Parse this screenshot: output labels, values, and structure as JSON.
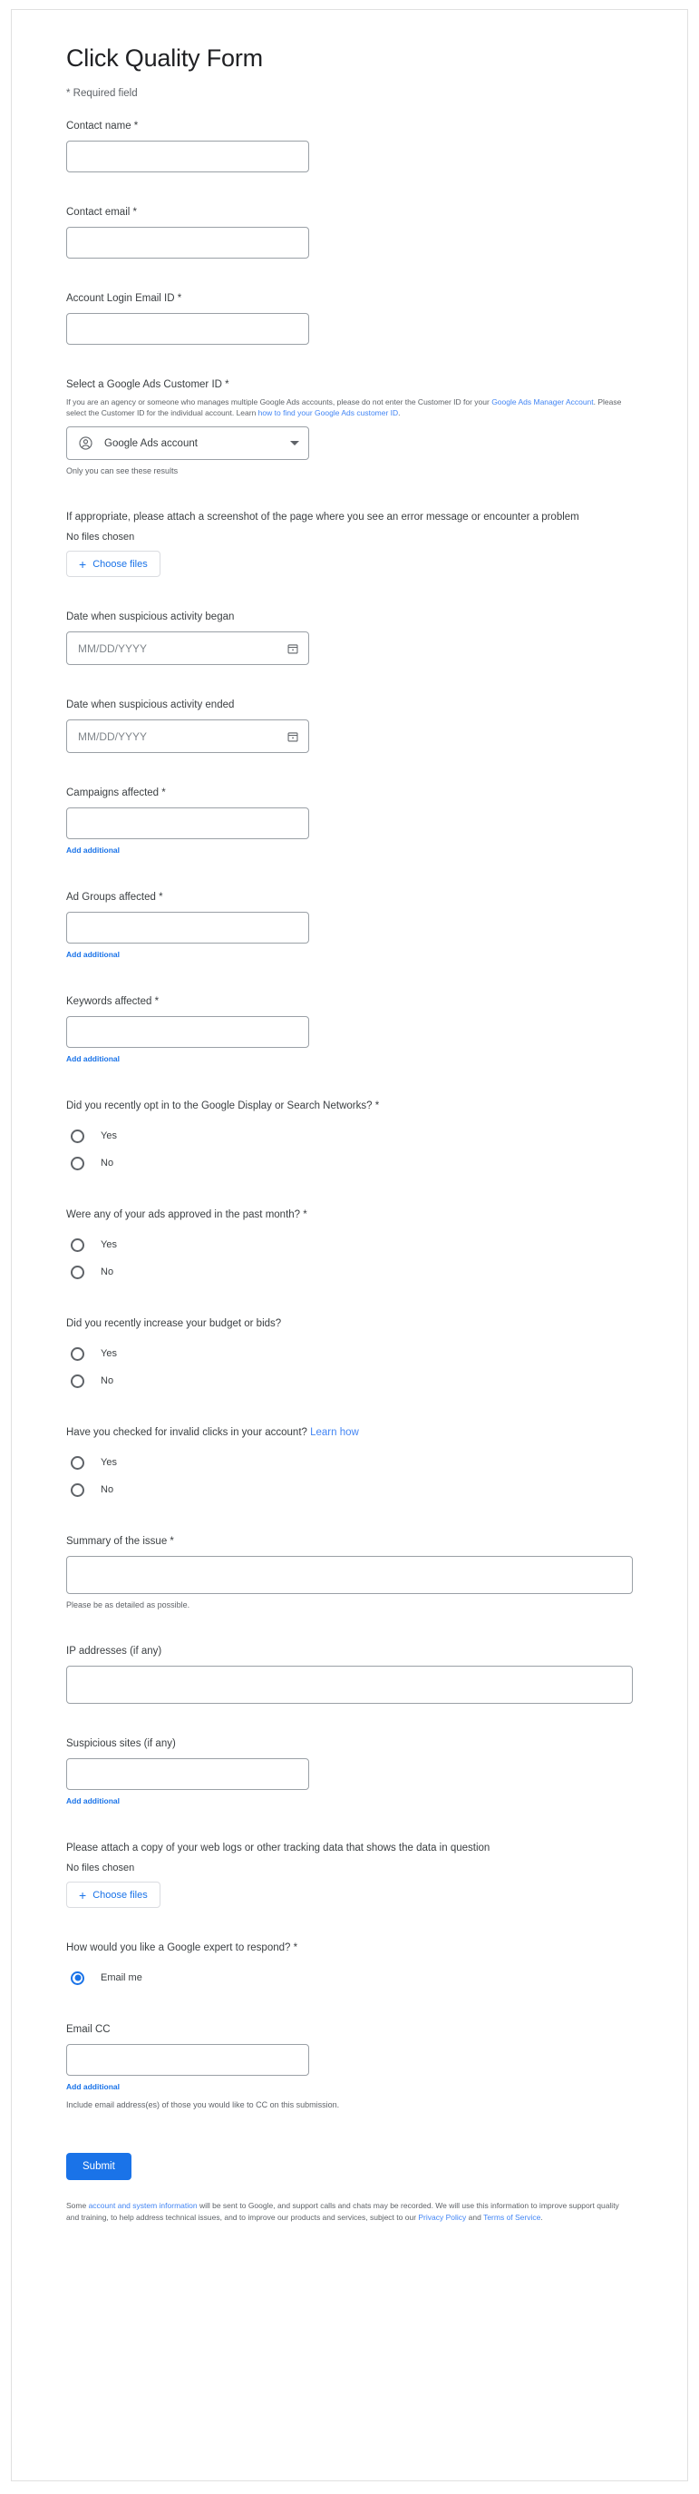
{
  "form": {
    "title": "Click Quality Form",
    "required_note": "* Required field",
    "accent_color": "#1a73e8",
    "link_color": "#4285f4"
  },
  "fields": {
    "contact_name": {
      "label": "Contact name *",
      "value": "",
      "placeholder": ""
    },
    "contact_email": {
      "label": "Contact email *",
      "value": "",
      "placeholder": ""
    },
    "account_login_email": {
      "label": "Account Login Email ID *",
      "value": "",
      "placeholder": ""
    }
  },
  "customer_id": {
    "label": "Select a Google Ads Customer ID *",
    "help_part1": "If you are an agency or someone who manages multiple Google Ads accounts, please do not enter the Customer ID for your ",
    "help_link1": "Google Ads Manager Account",
    "help_part2": ". Please select the Customer ID for the individual account. Learn ",
    "help_link2": "how to find your Google Ads customer ID",
    "help_part3": ".",
    "selected_option": "Google Ads account",
    "icon": "account-circle-icon",
    "caret_icon": "chevron-down-icon",
    "sub_note": "Only you can see these results"
  },
  "screenshot_upload": {
    "label": "If appropriate, please attach a screenshot of the page where you see an error message or encounter a problem",
    "no_files_text": "No files chosen",
    "button_label": "Choose files",
    "plus_icon": "plus-icon"
  },
  "dates": {
    "began": {
      "label": "Date when suspicious activity began",
      "placeholder": "MM/DD/YYYY",
      "value": "",
      "icon": "calendar-icon"
    },
    "ended": {
      "label": "Date when suspicious activity ended",
      "placeholder": "MM/DD/YYYY",
      "value": "",
      "icon": "calendar-icon"
    }
  },
  "affected": {
    "campaigns": {
      "label": "Campaigns affected *",
      "value": "",
      "add_label": "Add additional"
    },
    "ad_groups": {
      "label": "Ad Groups affected *",
      "value": "",
      "add_label": "Add additional"
    },
    "keywords": {
      "label": "Keywords affected *",
      "value": "",
      "add_label": "Add additional"
    }
  },
  "questions": [
    {
      "label": "Did you recently opt in to the Google Display or Search Networks? *",
      "options": [
        "Yes",
        "No"
      ],
      "selected": null
    },
    {
      "label": "Were any of your ads approved in the past month? *",
      "options": [
        "Yes",
        "No"
      ],
      "selected": null
    },
    {
      "label": "Did you recently increase your budget or bids?",
      "options": [
        "Yes",
        "No"
      ],
      "selected": null
    },
    {
      "label": "Have you checked for invalid clicks in your account? ",
      "link_label": "Learn how",
      "options": [
        "Yes",
        "No"
      ],
      "selected": null
    }
  ],
  "summary": {
    "label": "Summary of the issue *",
    "value": "",
    "hint": "Please be as detailed as possible."
  },
  "ip_addresses": {
    "label": "IP addresses (if any)",
    "value": ""
  },
  "suspicious_sites": {
    "label": "Suspicious sites (if any)",
    "value": "",
    "add_label": "Add additional"
  },
  "weblogs_upload": {
    "label": "Please attach a copy of your web logs or other tracking data that shows the data in question",
    "no_files_text": "No files chosen",
    "button_label": "Choose files",
    "plus_icon": "plus-icon"
  },
  "respond": {
    "label": "How would you like a Google expert to respond? *",
    "options": [
      "Email me"
    ],
    "selected": "Email me"
  },
  "email_cc": {
    "label": "Email CC",
    "value": "",
    "add_label": "Add additional",
    "hint": "Include email address(es) of those you would like to CC on this submission."
  },
  "submit": {
    "label": "Submit"
  },
  "legal": {
    "part1": "Some ",
    "link1": "account and system information",
    "part2": " will be sent to Google, and support calls and chats may be recorded. We will use this information to improve support quality and training, to help address technical issues, and to improve our products and services, subject to our ",
    "link2": "Privacy Policy",
    "part3": " and ",
    "link3": "Terms of Service",
    "part4": "."
  }
}
